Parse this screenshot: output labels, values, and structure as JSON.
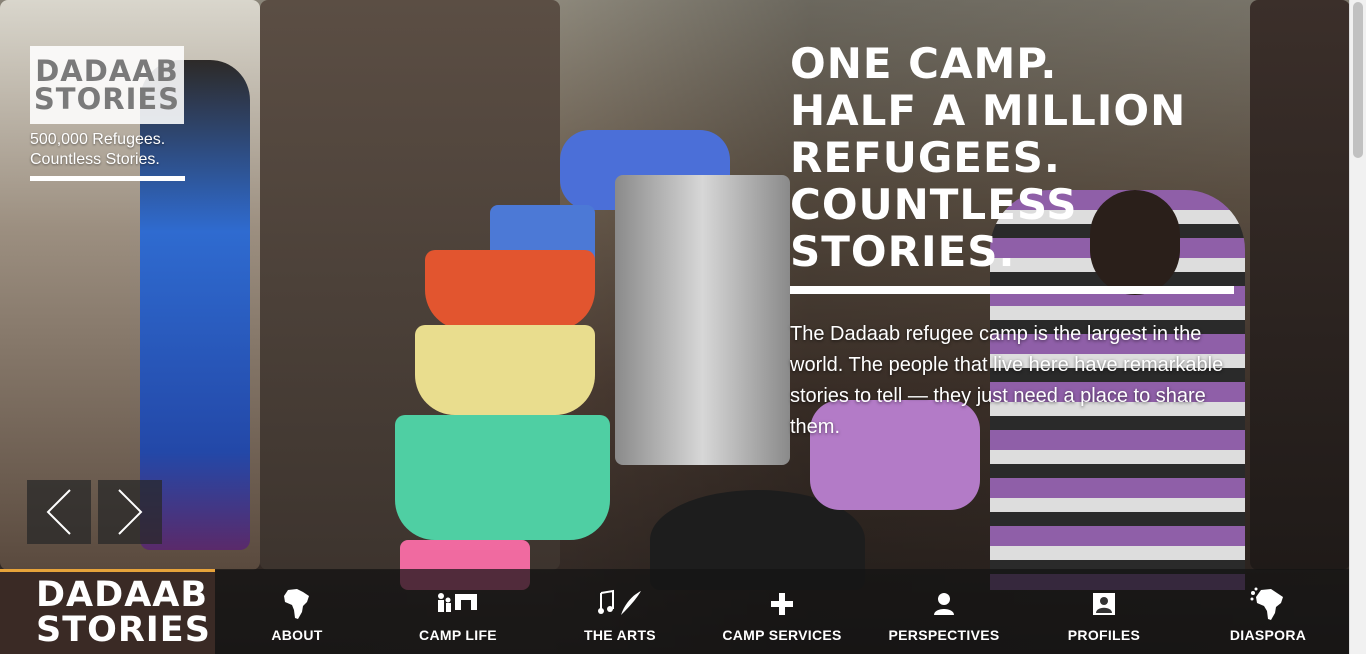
{
  "hero": {
    "logo_line1": "DADAAB",
    "logo_line2": "STORIES",
    "tagline_line1": "500,000 Refugees.",
    "tagline_line2": "Countless Stories.",
    "headline": [
      "ONE CAMP.",
      "HALF A MILLION",
      "REFUGEES.",
      "COUNTLESS",
      "STORIES."
    ],
    "intro": "The Dadaab refugee camp is the largest in the world. The people that live here have remarkable stories to tell — they just need a place to share them."
  },
  "slider": {
    "prev_icon": "chevron-left-icon",
    "next_icon": "chevron-right-icon"
  },
  "nav": {
    "logo_line1": "DADAAB",
    "logo_line2": "STORIES",
    "items": [
      {
        "label": "ABOUT",
        "icon": "africa-icon"
      },
      {
        "label": "CAMP LIFE",
        "icon": "family-shelter-icon"
      },
      {
        "label": "THE ARTS",
        "icon": "music-quill-icon"
      },
      {
        "label": "CAMP SERVICES",
        "icon": "plus-icon"
      },
      {
        "label": "PERSPECTIVES",
        "icon": "person-icon"
      },
      {
        "label": "PROFILES",
        "icon": "profile-card-icon"
      },
      {
        "label": "DIASPORA",
        "icon": "africa-dispersal-icon"
      }
    ]
  },
  "colors": {
    "accent": "#e7a33a",
    "nav_bg": "#3a2a25"
  }
}
